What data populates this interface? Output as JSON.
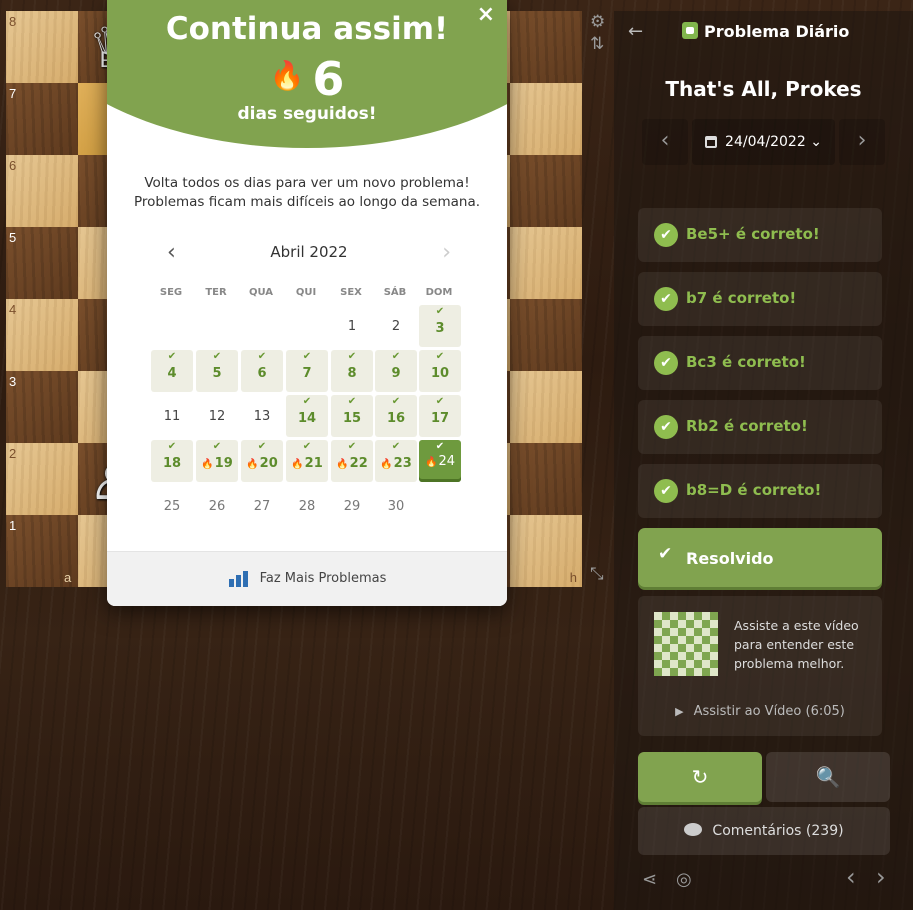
{
  "board": {
    "ranks": [
      "8",
      "7",
      "6",
      "5",
      "4",
      "3",
      "2",
      "1"
    ],
    "files_shown": [
      "a",
      "h"
    ],
    "pieces": [
      {
        "glyph": "♕",
        "name": "white-queen-piece",
        "square": "b8"
      },
      {
        "glyph": "♙",
        "name": "white-pawn-piece",
        "square": "b2"
      }
    ],
    "controls": {
      "settings_icon": "⚙",
      "flip_icon": "⇅",
      "expand_icon": "⤡"
    }
  },
  "modal": {
    "close": "×",
    "title": "Continua assim!",
    "streak_icon": "🔥",
    "streak_number": "6",
    "streak_label": "dias seguidos!",
    "description_line1": "Volta todos os dias para ver um novo problema!",
    "description_line2": "Problemas ficam mais difíceis ao longo da semana.",
    "calendar": {
      "month": "Abril 2022",
      "prev": "‹",
      "next": "›",
      "weekdays": [
        "SEG",
        "TER",
        "QUA",
        "QUI",
        "SEX",
        "SÁB",
        "DOM"
      ],
      "weeks": [
        [
          null,
          null,
          null,
          null,
          {
            "d": "1",
            "s": "past"
          },
          {
            "d": "2",
            "s": "past"
          },
          {
            "d": "3",
            "s": "solved"
          }
        ],
        [
          {
            "d": "4",
            "s": "solved"
          },
          {
            "d": "5",
            "s": "solved"
          },
          {
            "d": "6",
            "s": "solved"
          },
          {
            "d": "7",
            "s": "solved"
          },
          {
            "d": "8",
            "s": "solved"
          },
          {
            "d": "9",
            "s": "solved"
          },
          {
            "d": "10",
            "s": "solved"
          }
        ],
        [
          {
            "d": "11",
            "s": "past"
          },
          {
            "d": "12",
            "s": "past"
          },
          {
            "d": "13",
            "s": "past"
          },
          {
            "d": "14",
            "s": "solved"
          },
          {
            "d": "15",
            "s": "solved"
          },
          {
            "d": "16",
            "s": "solved"
          },
          {
            "d": "17",
            "s": "solved"
          }
        ],
        [
          {
            "d": "18",
            "s": "solved"
          },
          {
            "d": "19",
            "s": "streak"
          },
          {
            "d": "20",
            "s": "streak"
          },
          {
            "d": "21",
            "s": "streak"
          },
          {
            "d": "22",
            "s": "streak"
          },
          {
            "d": "23",
            "s": "streak"
          },
          {
            "d": "24",
            "s": "today"
          }
        ],
        [
          {
            "d": "25",
            "s": "future"
          },
          {
            "d": "26",
            "s": "future"
          },
          {
            "d": "27",
            "s": "future"
          },
          {
            "d": "28",
            "s": "future"
          },
          {
            "d": "29",
            "s": "future"
          },
          {
            "d": "30",
            "s": "future"
          },
          null
        ]
      ]
    },
    "footer_label": "Faz Mais Problemas"
  },
  "panel": {
    "back": "←",
    "title": "Problema Diário",
    "puzzle_name": "That's All, Prokes",
    "date": "24/04/2022",
    "date_chevron": "⌄",
    "prev": "‹",
    "next": "›",
    "moves": [
      "Be5+ é correto!",
      "b7 é correto!",
      "Bc3 é correto!",
      "Rb2 é correto!",
      "b8=D é correto!"
    ],
    "solved_label": "Resolvido",
    "video_text": "Assiste a este vídeo para entender este problema melhor.",
    "video_watch": "Assistir ao Vídeo (6:05)",
    "retry_icon": "↻",
    "analyze_icon": "🔍",
    "comments": "Comentários",
    "comments_count": "(239)",
    "share_icon": "⋖",
    "target_icon": "◎",
    "nav_prev": "‹",
    "nav_next": "›"
  },
  "colors": {
    "accent_green": "#81a34f",
    "move_green": "#8fbd4f",
    "streak_orange": "#e8932a"
  }
}
